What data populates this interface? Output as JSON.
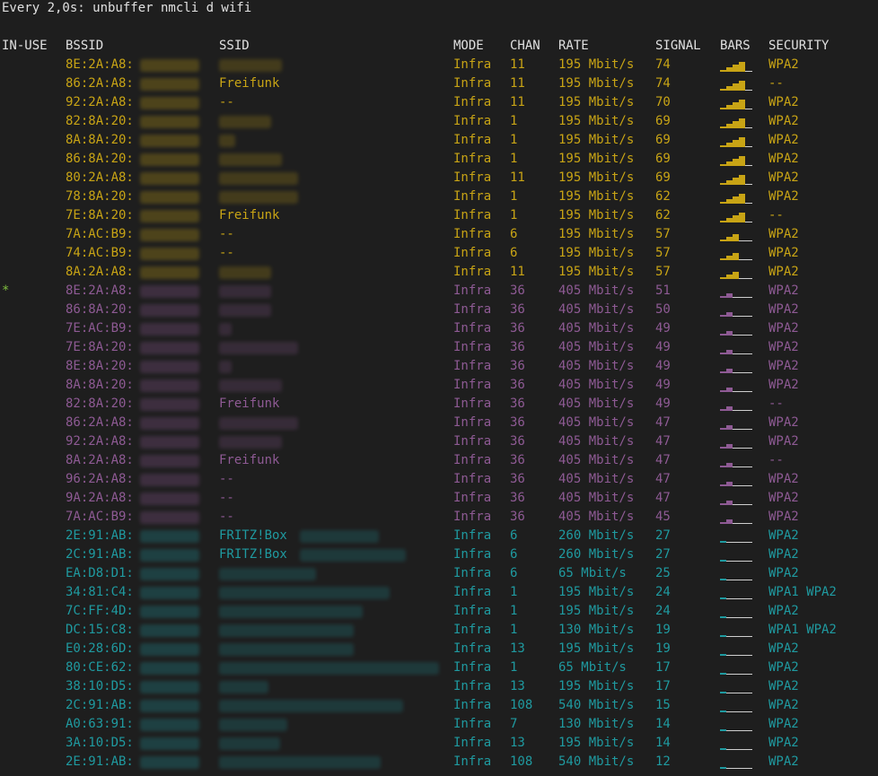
{
  "watch_header": "Every 2,0s: unbuffer nmcli d wifi",
  "columns": {
    "in_use": "IN-USE",
    "bssid": "BSSID",
    "ssid": "SSID",
    "mode": "MODE",
    "chan": "CHAN",
    "rate": "RATE",
    "signal": "SIGNAL",
    "bars": "BARS",
    "security": "SECURITY"
  },
  "colors": {
    "background": "#1e1e1e",
    "header_text": "#e0e0e0",
    "strong": "#c8a415",
    "medium": "#8e5a94",
    "weak": "#1f9aa0",
    "in_use_marker": "#7fbf3f"
  },
  "rows": [
    {
      "in_use": "",
      "bssid": "8E:2A:A8:",
      "ssid": "",
      "mode": "Infra",
      "chan": "11",
      "rate": "195 Mbit/s",
      "signal": "74",
      "bars": 4,
      "security": "WPA2",
      "tier": "strong"
    },
    {
      "in_use": "",
      "bssid": "86:2A:A8:",
      "ssid": "Freifunk",
      "mode": "Infra",
      "chan": "11",
      "rate": "195 Mbit/s",
      "signal": "74",
      "bars": 4,
      "security": "--",
      "tier": "strong"
    },
    {
      "in_use": "",
      "bssid": "92:2A:A8:",
      "ssid": "--",
      "mode": "Infra",
      "chan": "11",
      "rate": "195 Mbit/s",
      "signal": "70",
      "bars": 4,
      "security": "WPA2",
      "tier": "strong"
    },
    {
      "in_use": "",
      "bssid": "82:8A:20:",
      "ssid": "",
      "mode": "Infra",
      "chan": "1",
      "rate": "195 Mbit/s",
      "signal": "69",
      "bars": 4,
      "security": "WPA2",
      "tier": "strong"
    },
    {
      "in_use": "",
      "bssid": "8A:8A:20:",
      "ssid": "",
      "mode": "Infra",
      "chan": "1",
      "rate": "195 Mbit/s",
      "signal": "69",
      "bars": 4,
      "security": "WPA2",
      "tier": "strong"
    },
    {
      "in_use": "",
      "bssid": "86:8A:20:",
      "ssid": "",
      "mode": "Infra",
      "chan": "1",
      "rate": "195 Mbit/s",
      "signal": "69",
      "bars": 4,
      "security": "WPA2",
      "tier": "strong"
    },
    {
      "in_use": "",
      "bssid": "80:2A:A8:",
      "ssid": "",
      "mode": "Infra",
      "chan": "11",
      "rate": "195 Mbit/s",
      "signal": "69",
      "bars": 4,
      "security": "WPA2",
      "tier": "strong"
    },
    {
      "in_use": "",
      "bssid": "78:8A:20:",
      "ssid": "",
      "mode": "Infra",
      "chan": "1",
      "rate": "195 Mbit/s",
      "signal": "62",
      "bars": 4,
      "security": "WPA2",
      "tier": "strong"
    },
    {
      "in_use": "",
      "bssid": "7E:8A:20:",
      "ssid": "Freifunk",
      "mode": "Infra",
      "chan": "1",
      "rate": "195 Mbit/s",
      "signal": "62",
      "bars": 4,
      "security": "--",
      "tier": "strong"
    },
    {
      "in_use": "",
      "bssid": "7A:AC:B9:",
      "ssid": "--",
      "mode": "Infra",
      "chan": "6",
      "rate": "195 Mbit/s",
      "signal": "57",
      "bars": 3,
      "security": "WPA2",
      "tier": "strong"
    },
    {
      "in_use": "",
      "bssid": "74:AC:B9:",
      "ssid": "--",
      "mode": "Infra",
      "chan": "6",
      "rate": "195 Mbit/s",
      "signal": "57",
      "bars": 3,
      "security": "WPA2",
      "tier": "strong"
    },
    {
      "in_use": "",
      "bssid": "8A:2A:A8:",
      "ssid": "",
      "mode": "Infra",
      "chan": "11",
      "rate": "195 Mbit/s",
      "signal": "57",
      "bars": 3,
      "security": "WPA2",
      "tier": "strong"
    },
    {
      "in_use": "*",
      "bssid": "8E:2A:A8:",
      "ssid": "",
      "mode": "Infra",
      "chan": "36",
      "rate": "405 Mbit/s",
      "signal": "51",
      "bars": 2,
      "security": "WPA2",
      "tier": "medium"
    },
    {
      "in_use": "",
      "bssid": "86:8A:20:",
      "ssid": "",
      "mode": "Infra",
      "chan": "36",
      "rate": "405 Mbit/s",
      "signal": "50",
      "bars": 2,
      "security": "WPA2",
      "tier": "medium"
    },
    {
      "in_use": "",
      "bssid": "7E:AC:B9:",
      "ssid": "",
      "mode": "Infra",
      "chan": "36",
      "rate": "405 Mbit/s",
      "signal": "49",
      "bars": 2,
      "security": "WPA2",
      "tier": "medium"
    },
    {
      "in_use": "",
      "bssid": "7E:8A:20:",
      "ssid": "",
      "mode": "Infra",
      "chan": "36",
      "rate": "405 Mbit/s",
      "signal": "49",
      "bars": 2,
      "security": "WPA2",
      "tier": "medium"
    },
    {
      "in_use": "",
      "bssid": "8E:8A:20:",
      "ssid": "",
      "mode": "Infra",
      "chan": "36",
      "rate": "405 Mbit/s",
      "signal": "49",
      "bars": 2,
      "security": "WPA2",
      "tier": "medium"
    },
    {
      "in_use": "",
      "bssid": "8A:8A:20:",
      "ssid": "",
      "mode": "Infra",
      "chan": "36",
      "rate": "405 Mbit/s",
      "signal": "49",
      "bars": 2,
      "security": "WPA2",
      "tier": "medium"
    },
    {
      "in_use": "",
      "bssid": "82:8A:20:",
      "ssid": "Freifunk",
      "mode": "Infra",
      "chan": "36",
      "rate": "405 Mbit/s",
      "signal": "49",
      "bars": 2,
      "security": "--",
      "tier": "medium"
    },
    {
      "in_use": "",
      "bssid": "86:2A:A8:",
      "ssid": "",
      "mode": "Infra",
      "chan": "36",
      "rate": "405 Mbit/s",
      "signal": "47",
      "bars": 2,
      "security": "WPA2",
      "tier": "medium"
    },
    {
      "in_use": "",
      "bssid": "92:2A:A8:",
      "ssid": "",
      "mode": "Infra",
      "chan": "36",
      "rate": "405 Mbit/s",
      "signal": "47",
      "bars": 2,
      "security": "WPA2",
      "tier": "medium"
    },
    {
      "in_use": "",
      "bssid": "8A:2A:A8:",
      "ssid": "Freifunk",
      "mode": "Infra",
      "chan": "36",
      "rate": "405 Mbit/s",
      "signal": "47",
      "bars": 2,
      "security": "--",
      "tier": "medium"
    },
    {
      "in_use": "",
      "bssid": "96:2A:A8:",
      "ssid": "--",
      "mode": "Infra",
      "chan": "36",
      "rate": "405 Mbit/s",
      "signal": "47",
      "bars": 2,
      "security": "WPA2",
      "tier": "medium"
    },
    {
      "in_use": "",
      "bssid": "9A:2A:A8:",
      "ssid": "--",
      "mode": "Infra",
      "chan": "36",
      "rate": "405 Mbit/s",
      "signal": "47",
      "bars": 2,
      "security": "WPA2",
      "tier": "medium"
    },
    {
      "in_use": "",
      "bssid": "7A:AC:B9:",
      "ssid": "--",
      "mode": "Infra",
      "chan": "36",
      "rate": "405 Mbit/s",
      "signal": "45",
      "bars": 2,
      "security": "WPA2",
      "tier": "medium"
    },
    {
      "in_use": "",
      "bssid": "2E:91:AB:",
      "ssid": "FRITZ!Box",
      "mode": "Infra",
      "chan": "6",
      "rate": "260 Mbit/s",
      "signal": "27",
      "bars": 1,
      "security": "WPA2",
      "tier": "weak"
    },
    {
      "in_use": "",
      "bssid": "2C:91:AB:",
      "ssid": "FRITZ!Box",
      "mode": "Infra",
      "chan": "6",
      "rate": "260 Mbit/s",
      "signal": "27",
      "bars": 1,
      "security": "WPA2",
      "tier": "weak"
    },
    {
      "in_use": "",
      "bssid": "EA:D8:D1:",
      "ssid": "",
      "mode": "Infra",
      "chan": "6",
      "rate": "65 Mbit/s",
      "signal": "25",
      "bars": 1,
      "security": "WPA2",
      "tier": "weak"
    },
    {
      "in_use": "",
      "bssid": "34:81:C4:",
      "ssid": "",
      "mode": "Infra",
      "chan": "1",
      "rate": "195 Mbit/s",
      "signal": "24",
      "bars": 1,
      "security": "WPA1 WPA2",
      "tier": "weak"
    },
    {
      "in_use": "",
      "bssid": "7C:FF:4D:",
      "ssid": "",
      "mode": "Infra",
      "chan": "1",
      "rate": "195 Mbit/s",
      "signal": "24",
      "bars": 1,
      "security": "WPA2",
      "tier": "weak"
    },
    {
      "in_use": "",
      "bssid": "DC:15:C8:",
      "ssid": "",
      "mode": "Infra",
      "chan": "1",
      "rate": "130 Mbit/s",
      "signal": "19",
      "bars": 1,
      "security": "WPA1 WPA2",
      "tier": "weak"
    },
    {
      "in_use": "",
      "bssid": "E0:28:6D:",
      "ssid": "",
      "mode": "Infra",
      "chan": "13",
      "rate": "195 Mbit/s",
      "signal": "19",
      "bars": 1,
      "security": "WPA2",
      "tier": "weak"
    },
    {
      "in_use": "",
      "bssid": "80:CE:62:",
      "ssid": "",
      "mode": "Infra",
      "chan": "1",
      "rate": "65 Mbit/s",
      "signal": "17",
      "bars": 1,
      "security": "WPA2",
      "tier": "weak"
    },
    {
      "in_use": "",
      "bssid": "38:10:D5:",
      "ssid": "",
      "mode": "Infra",
      "chan": "13",
      "rate": "195 Mbit/s",
      "signal": "17",
      "bars": 1,
      "security": "WPA2",
      "tier": "weak"
    },
    {
      "in_use": "",
      "bssid": "2C:91:AB:",
      "ssid": "",
      "mode": "Infra",
      "chan": "108",
      "rate": "540 Mbit/s",
      "signal": "15",
      "bars": 1,
      "security": "WPA2",
      "tier": "weak"
    },
    {
      "in_use": "",
      "bssid": "A0:63:91:",
      "ssid": "",
      "mode": "Infra",
      "chan": "7",
      "rate": "130 Mbit/s",
      "signal": "14",
      "bars": 1,
      "security": "WPA2",
      "tier": "weak"
    },
    {
      "in_use": "",
      "bssid": "3A:10:D5:",
      "ssid": "",
      "mode": "Infra",
      "chan": "13",
      "rate": "195 Mbit/s",
      "signal": "14",
      "bars": 1,
      "security": "WPA2",
      "tier": "weak"
    },
    {
      "in_use": "",
      "bssid": "2E:91:AB:",
      "ssid": "",
      "mode": "Infra",
      "chan": "108",
      "rate": "540 Mbit/s",
      "signal": "12",
      "bars": 1,
      "security": "WPA2",
      "tier": "weak"
    }
  ]
}
